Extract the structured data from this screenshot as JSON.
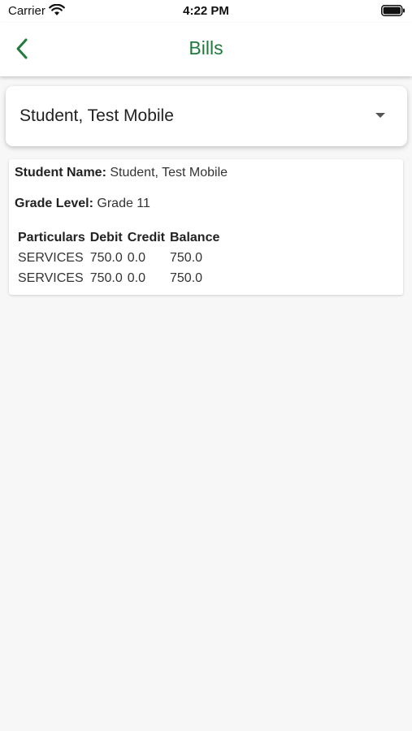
{
  "status_bar": {
    "carrier": "Carrier",
    "time": "4:22 PM"
  },
  "app_bar": {
    "title": "Bills",
    "back_icon": "chevron-left-icon",
    "accent_color": "#1f7a3c"
  },
  "student_select": {
    "selected_value": "Student, Test Mobile",
    "arrow_icon": "dropdown-arrow-icon"
  },
  "bill_card": {
    "student_name_label": "Student Name:",
    "student_name_value": "Student, Test Mobile",
    "grade_level_label": "Grade Level:",
    "grade_level_value": "Grade 11",
    "table": {
      "headers": [
        "Particulars",
        "Debit",
        "Credit",
        "Balance"
      ],
      "rows": [
        [
          "SERVICES",
          "750.0",
          "0.0",
          "750.0"
        ],
        [
          "SERVICES",
          "750.0",
          "0.0",
          "750.0"
        ]
      ]
    }
  }
}
